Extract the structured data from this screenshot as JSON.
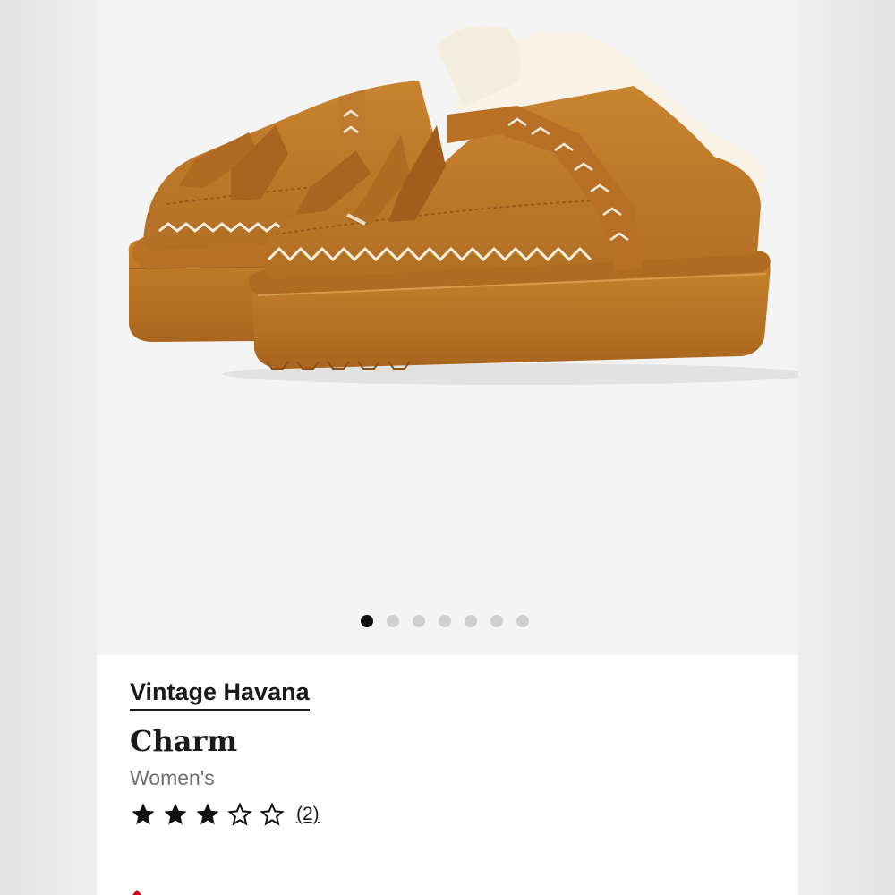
{
  "product": {
    "brand": "Vintage Havana",
    "name": "Charm",
    "gender": "Women's",
    "rating": 3,
    "rating_max": 5,
    "review_count_label": "(2)"
  },
  "gallery": {
    "image_count": 7,
    "active_index": 0
  },
  "colors": {
    "suede": "#c07a2c",
    "fleece": "#f8f3e6",
    "star_fill": "#111111",
    "dot_active": "#111111",
    "dot_inactive": "#cfcfcf"
  }
}
